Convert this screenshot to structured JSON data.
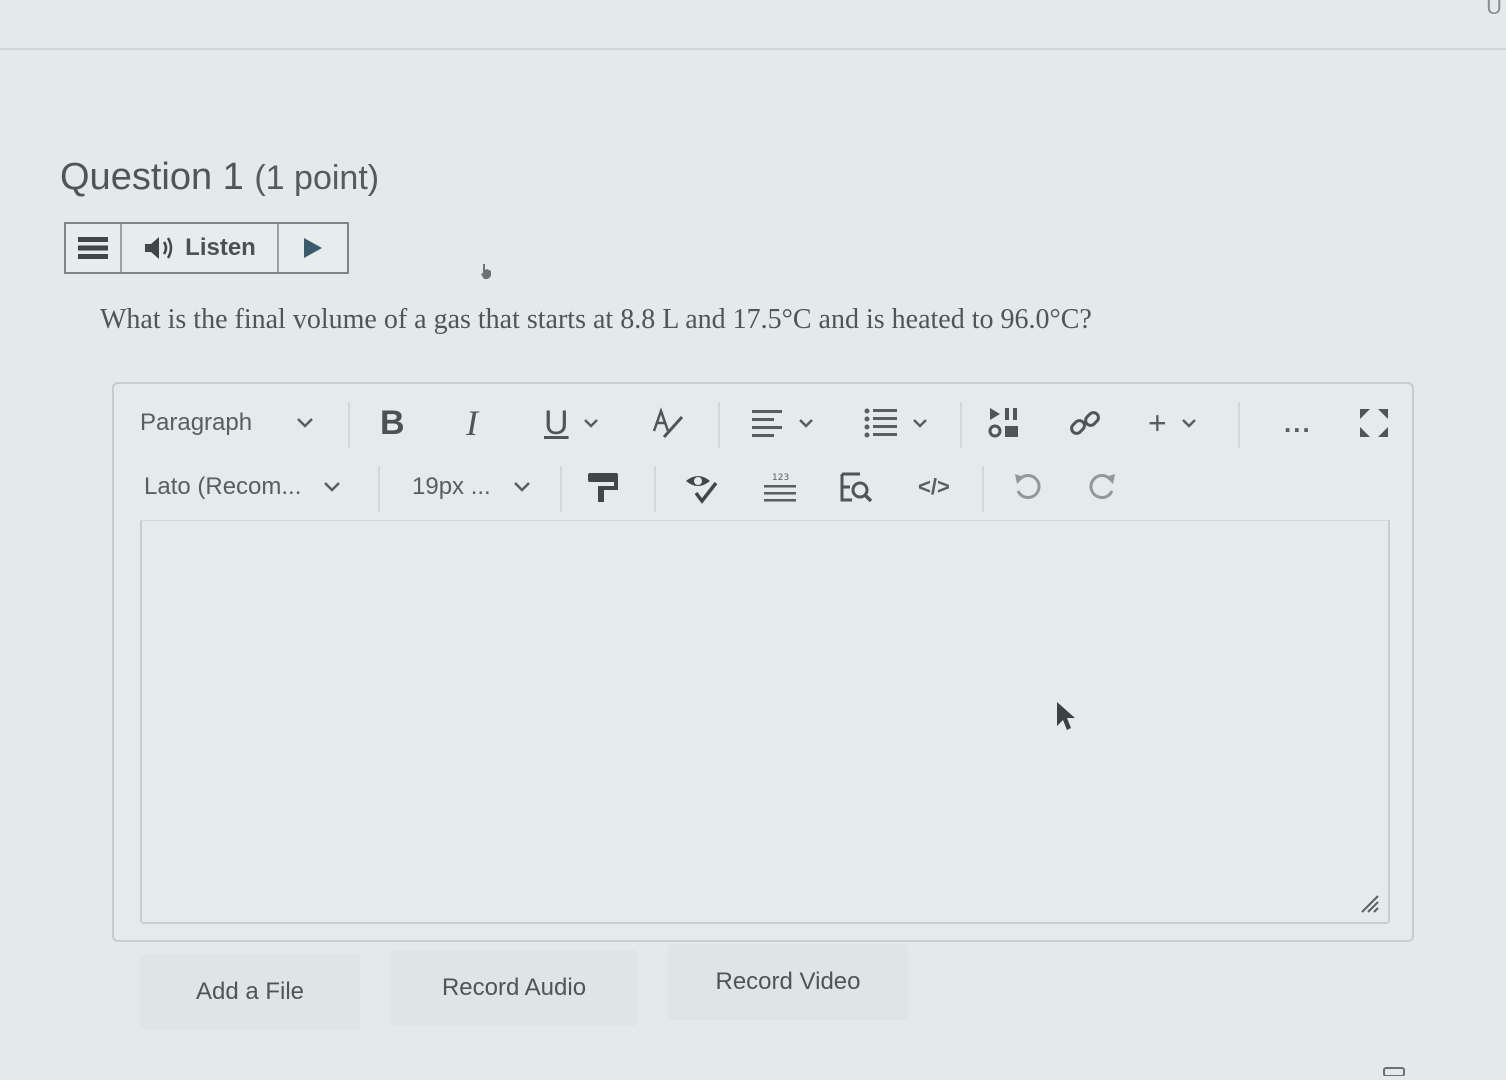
{
  "corner_text": "U",
  "question": {
    "title": "Question 1",
    "points": "(1 point)",
    "text": "What is the final volume of a gas that starts at 8.8 L and 17.5°C and is heated to 96.0°C?"
  },
  "listen_bar": {
    "menu_icon": "menu-icon",
    "speaker_icon": "speaker-icon",
    "label": "Listen",
    "play_icon": "play-icon"
  },
  "toolbar": {
    "block_format": "Paragraph",
    "font_family": "Lato (Recom...",
    "font_size": "19px ...",
    "bold_label": "B",
    "italic_label": "I",
    "underline_label": "U",
    "more_label": "...",
    "code_label": "</>",
    "insert_label": "+",
    "icons": [
      "chevron-down-icon",
      "strikethrough-icon",
      "align-icon",
      "list-icon",
      "media-icon",
      "link-icon",
      "insert-icon",
      "more-icon",
      "fullscreen-icon",
      "format-painter-icon",
      "accessibility-check-icon",
      "word-count-icon",
      "find-replace-icon",
      "source-code-icon",
      "undo-icon",
      "redo-icon"
    ]
  },
  "attachments": {
    "add_file": "Add a File",
    "record_audio": "Record Audio",
    "record_video": "Record Video"
  },
  "colors": {
    "background": "#e4e9ea",
    "text": "#4a5254",
    "play_accent": "#3d5a6c"
  }
}
